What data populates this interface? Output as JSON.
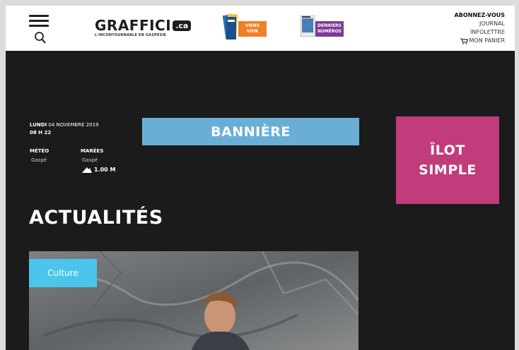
{
  "header": {
    "logo": {
      "name": "GRAFFICI",
      "suffix": ".ca",
      "tagline": "L'INCONTOURNABLE EN GASPÉSIE"
    },
    "promo_viens_voir": {
      "line1": "VIENS",
      "line2": "VOIR",
      "color": "#f07f25"
    },
    "promo_derniers_numeros": {
      "line1": "DERNIERS",
      "line2": "NUMÉROS",
      "color": "#7c3b96"
    },
    "account": {
      "subscribe": "ABONNEZ-VOUS",
      "journal": "JOURNAL",
      "newsletter": "INFOLETTRE",
      "cart": "MON PANIER"
    },
    "icons": {
      "menu": "hamburger-icon",
      "search": "search-icon",
      "cart": "cart-icon"
    }
  },
  "info": {
    "day": "LUNDI",
    "date": "04 NOVEMBRE 2019",
    "time": "08 H 22",
    "weather_label": "MÉTÉO",
    "weather_location": "Gaspé",
    "tide_label": "MARÉES",
    "tide_location": "Gaspé",
    "tide_value": "1.00 M"
  },
  "banner": {
    "label": "BANNIÈRE",
    "color": "#6aaed5"
  },
  "ilot": {
    "line1": "ÎLOT",
    "line2": "SIMPLE",
    "color": "#c13c7b"
  },
  "main": {
    "section_title": "ACTUALITÉS",
    "article": {
      "category": "Culture",
      "category_color": "#4cc5ec"
    }
  },
  "colors": {
    "page_bg": "#1b1b1b",
    "header_bg": "#ffffff"
  }
}
